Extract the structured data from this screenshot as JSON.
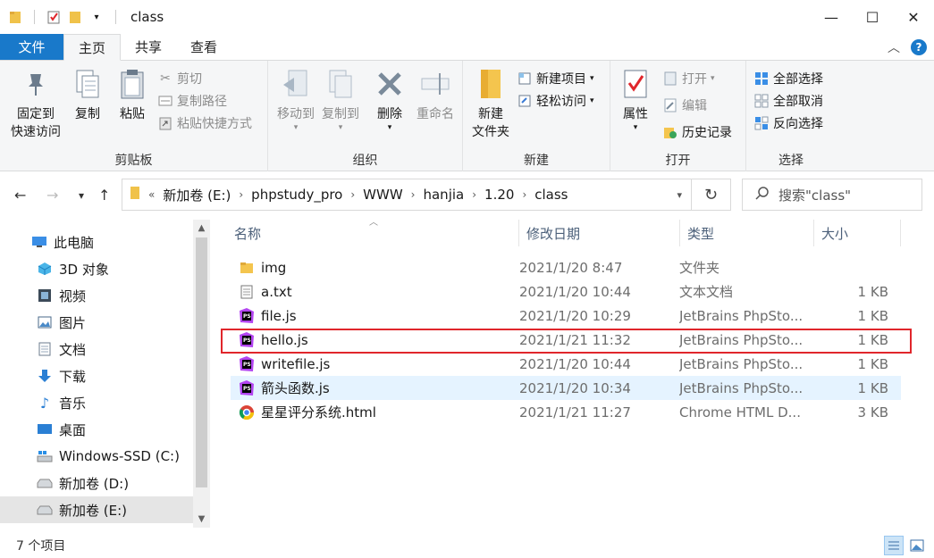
{
  "window": {
    "title": "class"
  },
  "tabs": {
    "file": "文件",
    "home": "主页",
    "share": "共享",
    "view": "查看"
  },
  "ribbon": {
    "clipboard": {
      "label": "剪贴板",
      "pin_line1": "固定到",
      "pin_line2": "快速访问",
      "copy": "复制",
      "paste": "粘贴",
      "cut": "剪切",
      "copy_path": "复制路径",
      "paste_shortcut": "粘贴快捷方式"
    },
    "organize": {
      "label": "组织",
      "move_to": "移动到",
      "copy_to": "复制到",
      "delete": "删除",
      "rename": "重命名"
    },
    "new": {
      "label": "新建",
      "new_folder_line1": "新建",
      "new_folder_line2": "文件夹",
      "new_item": "新建项目",
      "easy_access": "轻松访问"
    },
    "open": {
      "label": "打开",
      "properties": "属性",
      "open": "打开",
      "edit": "编辑",
      "history": "历史记录"
    },
    "select": {
      "label": "选择",
      "select_all": "全部选择",
      "select_none": "全部取消",
      "invert": "反向选择"
    }
  },
  "address": {
    "prefix": "«",
    "crumbs": [
      "新加卷 (E:)",
      "phpstudy_pro",
      "WWW",
      "hanjia",
      "1.20",
      "class"
    ]
  },
  "search": {
    "placeholder": "搜索\"class\""
  },
  "nav": {
    "items": [
      "此电脑",
      "3D 对象",
      "视频",
      "图片",
      "文档",
      "下载",
      "音乐",
      "桌面",
      "Windows-SSD (C:)",
      "新加卷 (D:)",
      "新加卷 (E:)"
    ]
  },
  "columns": {
    "name": "名称",
    "date": "修改日期",
    "type": "类型",
    "size": "大小"
  },
  "files": [
    {
      "name": "img",
      "date": "2021/1/20 8:47",
      "type": "文件夹",
      "size": "",
      "icon": "folder-icon"
    },
    {
      "name": "a.txt",
      "date": "2021/1/20 10:44",
      "type": "文本文档",
      "size": "1 KB",
      "icon": "text-file-icon"
    },
    {
      "name": "file.js",
      "date": "2021/1/20 10:29",
      "type": "JetBrains PhpSto...",
      "size": "1 KB",
      "icon": "phpstorm-icon"
    },
    {
      "name": "hello.js",
      "date": "2021/1/21 11:32",
      "type": "JetBrains PhpSto...",
      "size": "1 KB",
      "icon": "phpstorm-icon"
    },
    {
      "name": "writefile.js",
      "date": "2021/1/20 10:44",
      "type": "JetBrains PhpSto...",
      "size": "1 KB",
      "icon": "phpstorm-icon"
    },
    {
      "name": "箭头函数.js",
      "date": "2021/1/20 10:34",
      "type": "JetBrains PhpSto...",
      "size": "1 KB",
      "icon": "phpstorm-icon"
    },
    {
      "name": "星星评分系统.html",
      "date": "2021/1/21 11:27",
      "type": "Chrome HTML D...",
      "size": "3 KB",
      "icon": "chrome-icon"
    }
  ],
  "status": {
    "count": "7 个项目"
  },
  "colors": {
    "accent": "#1979ca",
    "highlight_border": "#e0262b",
    "hover_row": "#e5f3ff"
  }
}
